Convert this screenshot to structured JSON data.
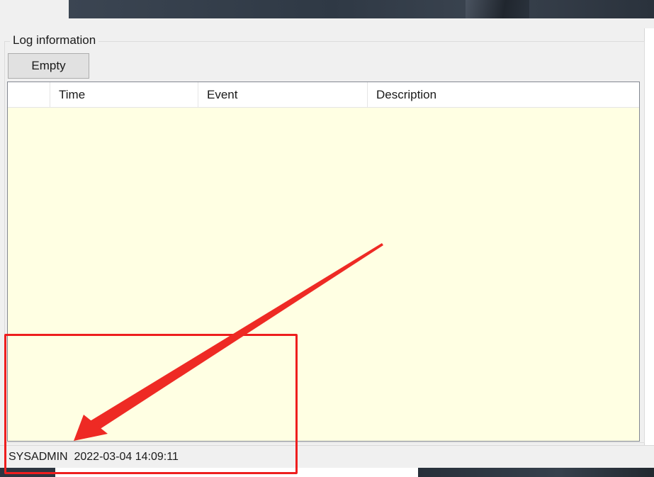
{
  "log_panel": {
    "title": "Log information",
    "empty_button_label": "Empty",
    "columns": [
      "",
      "Time",
      "Event",
      "Description"
    ],
    "rows": []
  },
  "status_bar": {
    "user": "SYSADMIN",
    "datetime": "2022-03-04 14:09:11"
  },
  "colors": {
    "annotation": "#ee1e1e",
    "table_background": "#ffffe3"
  },
  "icons": [
    "annotation-arrow-icon"
  ]
}
